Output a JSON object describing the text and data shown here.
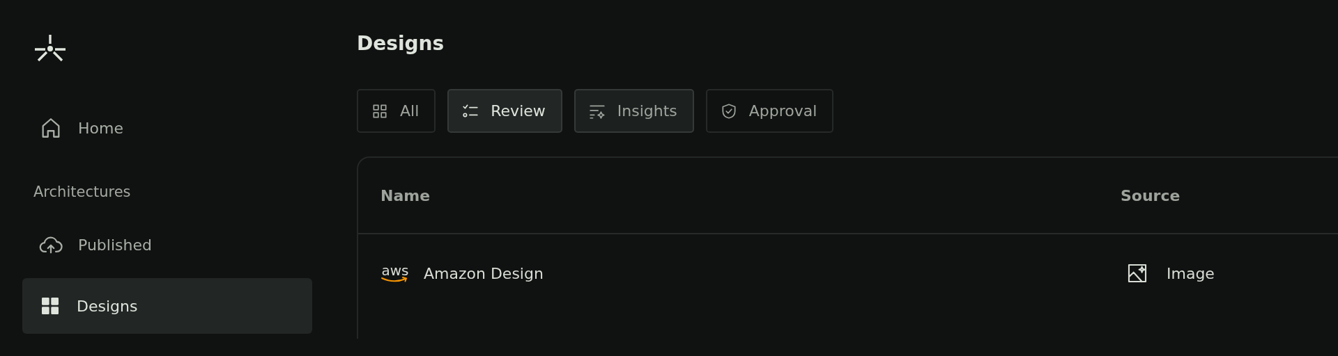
{
  "sidebar": {
    "items": [
      {
        "kind": "link",
        "label": "Home",
        "selected": false
      },
      {
        "kind": "section",
        "label": "Architectures"
      },
      {
        "kind": "link",
        "label": "Published",
        "selected": false
      },
      {
        "kind": "link",
        "label": "Designs",
        "selected": true
      }
    ]
  },
  "page": {
    "title": "Designs"
  },
  "tabs": [
    {
      "label": "All",
      "selected": false,
      "hovered": false
    },
    {
      "label": "Review",
      "selected": true,
      "hovered": false
    },
    {
      "label": "Insights",
      "selected": false,
      "hovered": true
    },
    {
      "label": "Approval",
      "selected": false,
      "hovered": false
    }
  ],
  "table": {
    "columns": [
      "Name",
      "Source"
    ],
    "rows": [
      {
        "logo": "aws",
        "name": "Amazon Design",
        "source": "Image"
      }
    ]
  }
}
